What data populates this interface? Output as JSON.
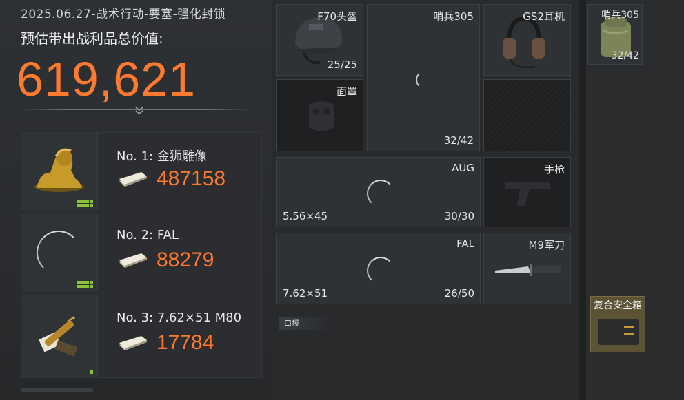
{
  "summary": {
    "date_mode": "2025.06.27-战术行动-要塞-强化封锁",
    "value_label": "预估带出战利品总价值:",
    "total_value": "619,621"
  },
  "loot_list": [
    {
      "rank": "No. 1: 金狮雕像",
      "price": "487158"
    },
    {
      "rank": "No. 2: FAL",
      "price": "88279"
    },
    {
      "rank": "No. 3: 7.62×51 M80",
      "price": "17784"
    }
  ],
  "inventory": {
    "helmet": {
      "label": "F70头盔",
      "count": "25/25"
    },
    "armor": {
      "label": "哨兵305",
      "count": "32/42"
    },
    "headset": {
      "label": "GS2耳机"
    },
    "mask": {
      "label": "面罩"
    },
    "primary": {
      "label": "AUG",
      "ammo": "5.56×45",
      "count": "30/30"
    },
    "pistol": {
      "label": "手枪"
    },
    "secondary": {
      "label": "FAL",
      "ammo": "7.62×51",
      "count": "26/50"
    },
    "melee": {
      "label": "M9军刀"
    },
    "pocket_label": "口袋"
  },
  "right": {
    "backpack": {
      "label": "哨兵305",
      "count": "32/42"
    },
    "safe_box": {
      "label": "复合安全箱"
    }
  },
  "colors": {
    "accent": "#ff7a2e",
    "badge": "#8fc23b"
  }
}
